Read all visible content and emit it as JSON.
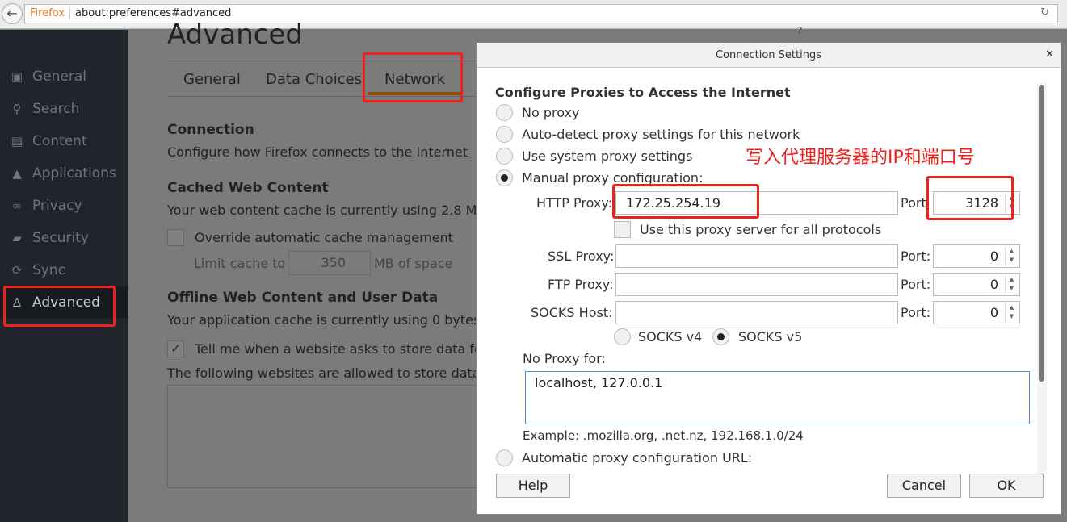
{
  "browser": {
    "brand": "Firefox",
    "url": "about:preferences#advanced"
  },
  "sidebar": {
    "items": [
      {
        "label": "General",
        "icon": "general-icon"
      },
      {
        "label": "Search",
        "icon": "search-icon"
      },
      {
        "label": "Content",
        "icon": "content-icon"
      },
      {
        "label": "Applications",
        "icon": "applications-icon"
      },
      {
        "label": "Privacy",
        "icon": "privacy-mask-icon"
      },
      {
        "label": "Security",
        "icon": "lock-icon"
      },
      {
        "label": "Sync",
        "icon": "sync-icon"
      },
      {
        "label": "Advanced",
        "icon": "wizard-hat-icon",
        "active": true
      }
    ]
  },
  "main": {
    "title": "Advanced",
    "tabs": [
      {
        "label": "General"
      },
      {
        "label": "Data Choices"
      },
      {
        "label": "Network",
        "active": true
      }
    ],
    "connection": {
      "heading": "Connection",
      "desc": "Configure how Firefox connects to the Internet"
    },
    "cache": {
      "heading": "Cached Web Content",
      "desc": "Your web content cache is currently using 2.8 M",
      "override_label": "Override automatic cache management",
      "override_checked": false,
      "limit_label": "Limit cache to",
      "limit_value": "350",
      "limit_unit": "MB of space"
    },
    "offline": {
      "heading": "Offline Web Content and User Data",
      "desc": "Your application cache is currently using 0 bytes",
      "tell_label": "Tell me when a website asks to store data fo",
      "tell_checked": true,
      "allowed_label": "The following websites are allowed to store data"
    }
  },
  "dialog": {
    "title": "Connection Settings",
    "heading": "Configure Proxies to Access the Internet",
    "options": {
      "no_proxy": "No proxy",
      "auto_detect": "Auto-detect proxy settings for this network",
      "system": "Use system proxy settings",
      "manual": "Manual proxy configuration:",
      "selected": "manual"
    },
    "http_label": "HTTP Proxy:",
    "http_value": "172.25.254.19",
    "http_port": "3128",
    "port_label": "Port",
    "port_label_colon": "Port:",
    "use_all_label": "Use this proxy server for all protocols",
    "use_all_checked": false,
    "ssl_label": "SSL Proxy:",
    "ssl_value": "",
    "ssl_port": "0",
    "ftp_label": "FTP Proxy:",
    "ftp_value": "",
    "ftp_port": "0",
    "socks_label": "SOCKS Host:",
    "socks_value": "",
    "socks_port": "0",
    "socks_v4": "SOCKS v4",
    "socks_v5": "SOCKS v5",
    "socks_selected": "v5",
    "no_proxy_for_label": "No Proxy for:",
    "no_proxy_for_value": "localhost, 127.0.0.1",
    "example": "Example: .mozilla.org, .net.nz, 192.168.1.0/24",
    "auto_url_label": "Automatic proxy configuration URL:",
    "help": "Help",
    "cancel": "Cancel",
    "ok": "OK"
  },
  "annotation": {
    "text": "写入代理服务器的IP和端口号",
    "color": "#f0201a"
  }
}
